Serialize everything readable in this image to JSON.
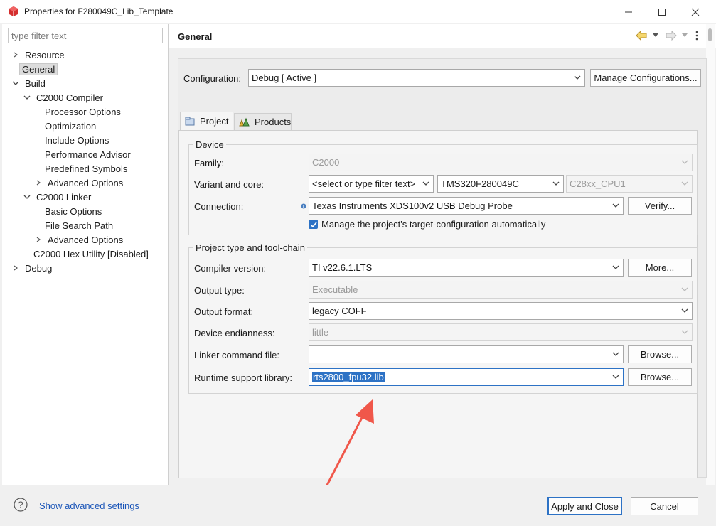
{
  "window": {
    "title": "Properties for F280049C_Lib_Template",
    "icon": "cube-icon",
    "controls": [
      "minimize",
      "maximize",
      "close"
    ]
  },
  "sidebar": {
    "filter_placeholder": "type filter text",
    "items": [
      {
        "label": "Resource"
      },
      {
        "label": "General"
      },
      {
        "label": "Build"
      },
      {
        "label": "C2000 Compiler"
      },
      {
        "label": "Processor Options"
      },
      {
        "label": "Optimization"
      },
      {
        "label": "Include Options"
      },
      {
        "label": "Performance Advisor"
      },
      {
        "label": "Predefined Symbols"
      },
      {
        "label": "Advanced Options"
      },
      {
        "label": "C2000 Linker"
      },
      {
        "label": "Basic Options"
      },
      {
        "label": "File Search Path"
      },
      {
        "label": "Advanced Options"
      },
      {
        "label": "C2000 Hex Utility  [Disabled]"
      },
      {
        "label": "Debug"
      }
    ]
  },
  "main": {
    "title": "General",
    "configuration": {
      "label": "Configuration:",
      "value": "Debug  [ Active ]",
      "manage_button": "Manage Configurations..."
    },
    "tabs": [
      {
        "label": "Project",
        "icon": "project-icon"
      },
      {
        "label": "Products",
        "icon": "products-icon"
      }
    ],
    "device": {
      "title": "Device",
      "family_label": "Family:",
      "family_value": "C2000",
      "variant_label": "Variant and core:",
      "variant_filter": "<select or type filter text>",
      "variant_value": "TMS320F280049C",
      "core_value": "C28xx_CPU1",
      "connection_label": "Connection:",
      "connection_value": "Texas Instruments XDS100v2 USB Debug Probe",
      "verify_button": "Verify...",
      "manage_check": "Manage the project's target-configuration automatically"
    },
    "toolchain": {
      "title": "Project type and tool-chain",
      "compiler_label": "Compiler version:",
      "compiler_value": "TI v22.6.1.LTS",
      "more_button": "More...",
      "output_type_label": "Output type:",
      "output_type_value": "Executable",
      "output_format_label": "Output format:",
      "output_format_value": "legacy COFF",
      "endianness_label": "Device endianness:",
      "endianness_value": "little",
      "linker_cmd_label": "Linker command file:",
      "linker_cmd_value": "",
      "browse_button": "Browse...",
      "runtime_label": "Runtime support library:",
      "runtime_value": "rts2800_fpu32.lib",
      "browse_button2": "Browse..."
    }
  },
  "footer": {
    "help_icon": "question-icon",
    "advanced_link": "Show advanced settings",
    "apply_button": "Apply and Close",
    "cancel_button": "Cancel"
  },
  "colors": {
    "accent": "#2d72c5",
    "annotation_arrow": "#f0574a"
  }
}
